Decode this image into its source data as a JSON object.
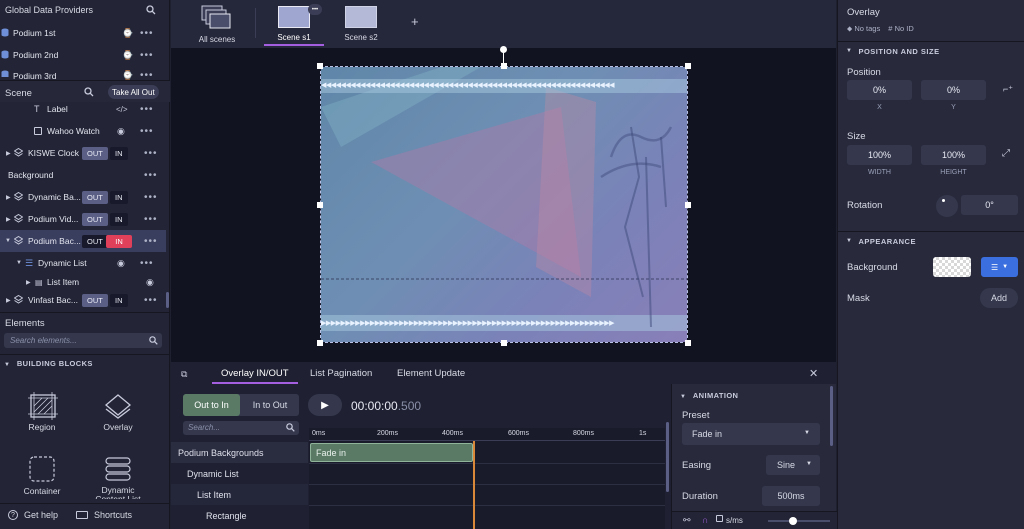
{
  "left": {
    "global_header": "Global Data Providers",
    "providers": [
      {
        "label": "Podium 1st"
      },
      {
        "label": "Podium 2nd"
      },
      {
        "label": "Podium 3rd"
      }
    ],
    "scene_header": "Scene",
    "take_all_out": "Take All Out",
    "scene_items": [
      {
        "label": "Label",
        "out": "",
        "in": ""
      },
      {
        "label": "Wahoo Watch",
        "out": "",
        "in": ""
      },
      {
        "label": "KISWE Clock",
        "out": "OUT",
        "in": "IN"
      },
      {
        "label": "Background",
        "out": "",
        "in": ""
      },
      {
        "label": "Dynamic Ba...",
        "out": "OUT",
        "in": "IN"
      },
      {
        "label": "Podium Vid...",
        "out": "OUT",
        "in": "IN"
      },
      {
        "label": "Podium Bac...",
        "out": "OUT",
        "in": "IN"
      },
      {
        "label": "Dynamic List",
        "out": "",
        "in": ""
      },
      {
        "label": "List Item",
        "out": "",
        "in": ""
      },
      {
        "label": "Vinfast Bac...",
        "out": "OUT",
        "in": "IN"
      }
    ],
    "elements_header": "Elements",
    "search_placeholder": "Search elements...",
    "building_blocks_header": "BUILDING BLOCKS",
    "blocks": [
      {
        "label": "Region",
        "icon": "region-icon"
      },
      {
        "label": "Overlay",
        "icon": "overlay-icon"
      },
      {
        "label": "Container",
        "icon": "container-icon"
      },
      {
        "label": "Dynamic Content List",
        "icon": "dynamic-list-icon"
      }
    ],
    "get_help": "Get help",
    "shortcuts": "Shortcuts"
  },
  "scenes": {
    "all_scenes": "All scenes",
    "tabs": [
      {
        "label": "Scene s1"
      },
      {
        "label": "Scene s2"
      }
    ],
    "more": "•••",
    "add": "+"
  },
  "right": {
    "title": "Overlay",
    "no_tags": "No tags",
    "no_id": "No ID",
    "position_size_header": "POSITION AND SIZE",
    "position_label": "Position",
    "x_value": "0%",
    "y_value": "0%",
    "x_cap": "X",
    "y_cap": "Y",
    "size_label": "Size",
    "width_value": "100%",
    "height_value": "100%",
    "width_cap": "WIDTH",
    "height_cap": "HEIGHT",
    "rotation_label": "Rotation",
    "rotation_value": "0°",
    "appearance_header": "APPEARANCE",
    "background_label": "Background",
    "mask_label": "Mask",
    "add_label": "Add"
  },
  "bottom": {
    "tabs": [
      {
        "label": "Overlay IN/OUT"
      },
      {
        "label": "List Pagination"
      },
      {
        "label": "Element Update"
      }
    ],
    "out_to_in": "Out to In",
    "in_to_out": "In to Out",
    "timecode": "00:00:00",
    "timecode_ms": ".500",
    "search_placeholder": "Search...",
    "ticks": [
      "0ms",
      "200ms",
      "400ms",
      "600ms",
      "800ms",
      "1s"
    ],
    "rows": [
      {
        "label": "Podium Backgrounds"
      },
      {
        "label": "Dynamic List"
      },
      {
        "label": "List Item"
      },
      {
        "label": "Rectangle"
      }
    ],
    "clip_label": "Fade in",
    "animation_header": "ANIMATION",
    "preset_label": "Preset",
    "preset_value": "Fade in",
    "easing_label": "Easing",
    "easing_value": "Sine",
    "duration_label": "Duration",
    "duration_value": "500ms",
    "speed_unit": "s/ms",
    "zoom_level": 0.4
  }
}
